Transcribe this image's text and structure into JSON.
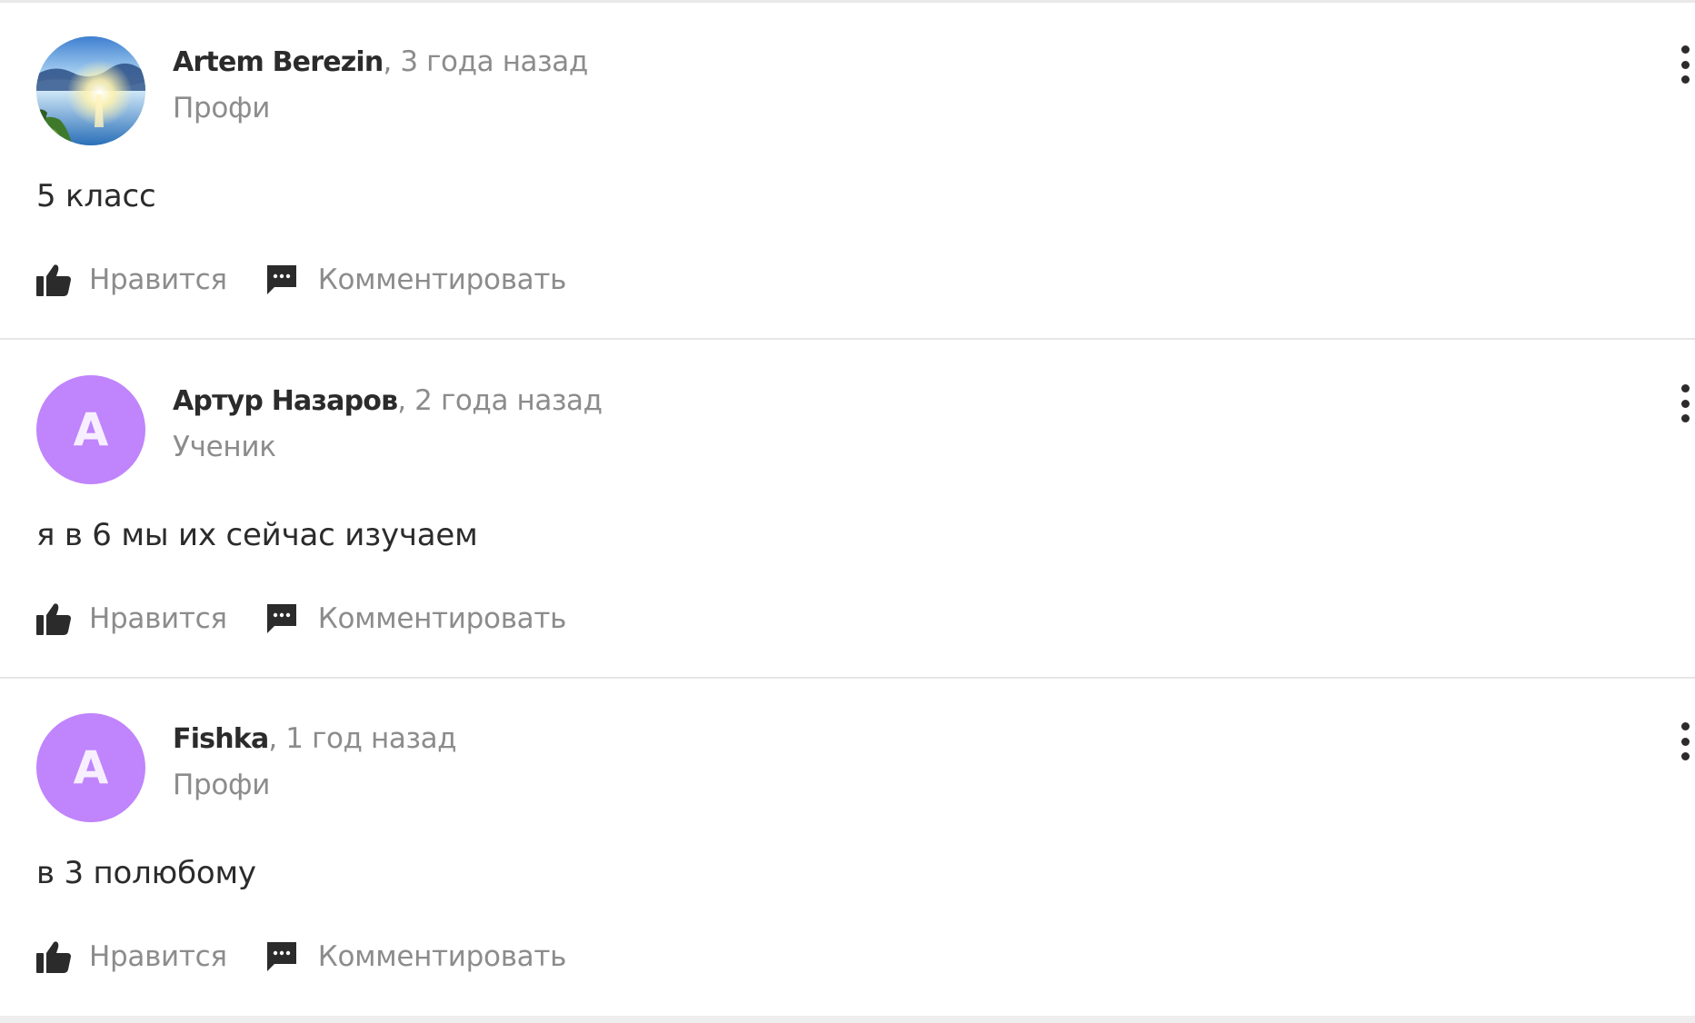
{
  "comments": [
    {
      "author": "Artem Berezin",
      "time": ", 3 года назад",
      "role": "Профи",
      "avatar_type": "photo",
      "text": "5 класс",
      "like_label": "Нравится",
      "comment_label": "Комментировать"
    },
    {
      "author": "Артур Назаров",
      "time": ", 2 года назад",
      "role": "Ученик",
      "avatar_type": "letter",
      "avatar_letter": "A",
      "text": "я в 6 мы их сейчас изучаем",
      "like_label": "Нравится",
      "comment_label": "Комментировать"
    },
    {
      "author": "Fishka",
      "time": ", 1 год назад",
      "role": "Профи",
      "avatar_type": "letter",
      "avatar_letter": "A",
      "text": "в 3 полюбому",
      "like_label": "Нравится",
      "comment_label": "Комментировать"
    }
  ],
  "icons": {
    "like": "thumbs-up-icon",
    "comment": "speech-bubble-icon",
    "menu": "kebab-menu-icon"
  },
  "colors": {
    "avatar_letter_bg": "#c084fc",
    "name_text": "#2b2b2b",
    "muted_text": "#8c8c8c",
    "divider": "#e6e6e6"
  }
}
